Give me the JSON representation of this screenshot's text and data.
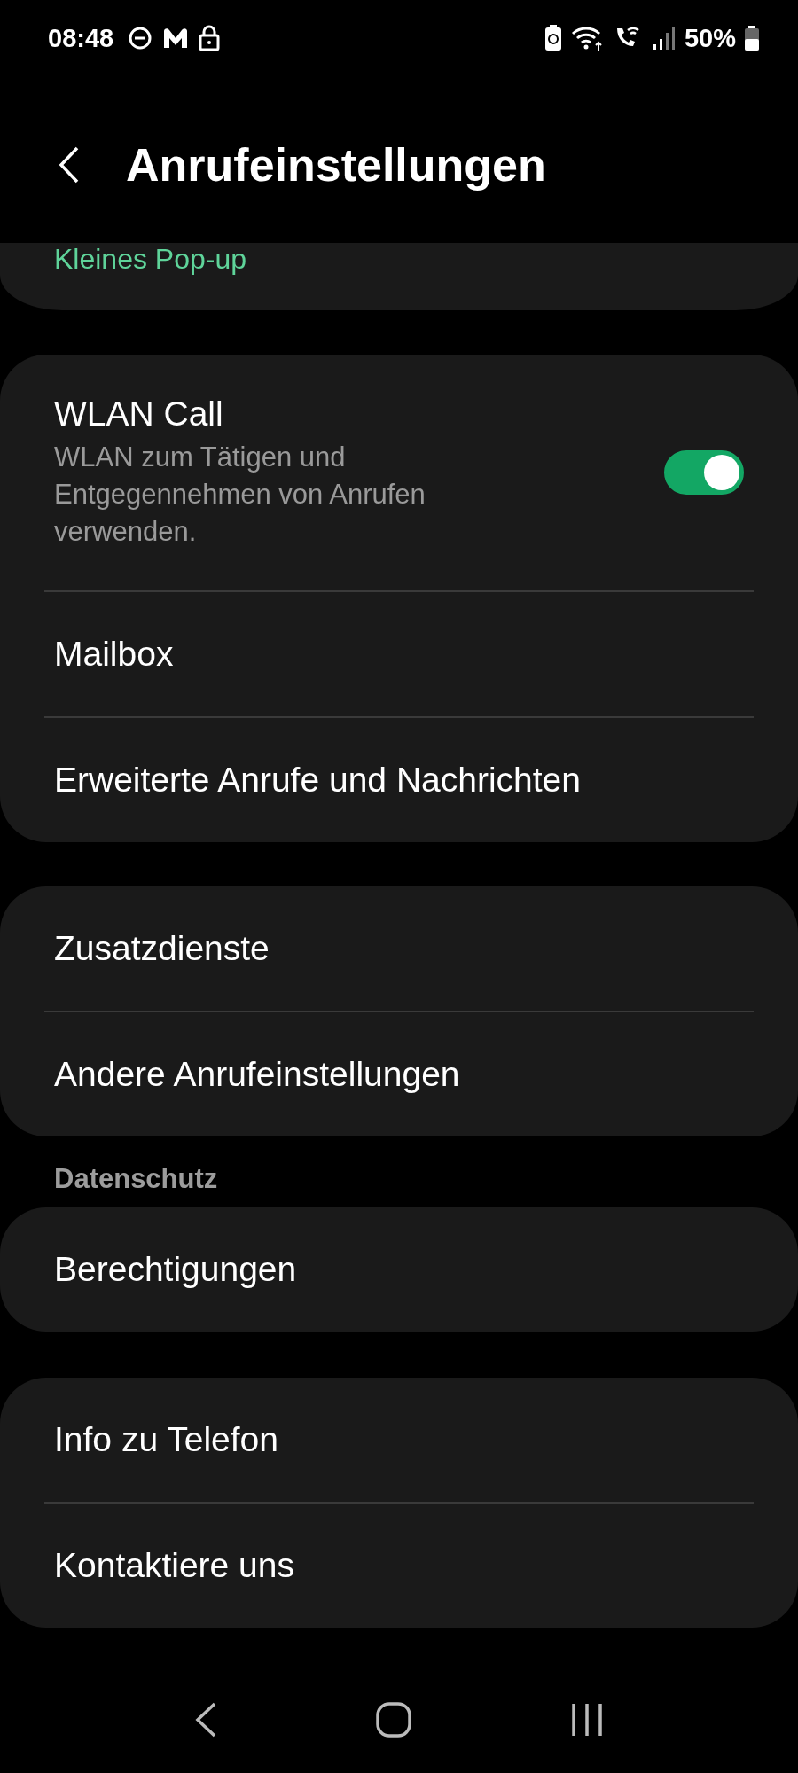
{
  "status_bar": {
    "time": "08:48",
    "battery": "50%"
  },
  "header": {
    "title": "Anrufeinstellungen"
  },
  "partial_card": {
    "value": "Kleines Pop-up"
  },
  "groups": [
    {
      "items": [
        {
          "kind": "toggle",
          "title": "WLAN Call",
          "subtitle": "WLAN zum Tätigen und Entgegennehmen von Anrufen verwenden.",
          "on": true
        },
        {
          "kind": "link",
          "title": "Mailbox"
        },
        {
          "kind": "link",
          "title": "Erweiterte Anrufe und Nachrichten"
        }
      ]
    },
    {
      "items": [
        {
          "kind": "link",
          "title": "Zusatzdienste"
        },
        {
          "kind": "link",
          "title": "Andere Anrufeinstellungen"
        }
      ]
    },
    {
      "section": "Datenschutz",
      "items": [
        {
          "kind": "link",
          "title": "Berechtigungen"
        }
      ]
    },
    {
      "items": [
        {
          "kind": "link",
          "title": "Info zu Telefon"
        },
        {
          "kind": "link",
          "title": "Kontaktiere uns"
        }
      ]
    }
  ]
}
